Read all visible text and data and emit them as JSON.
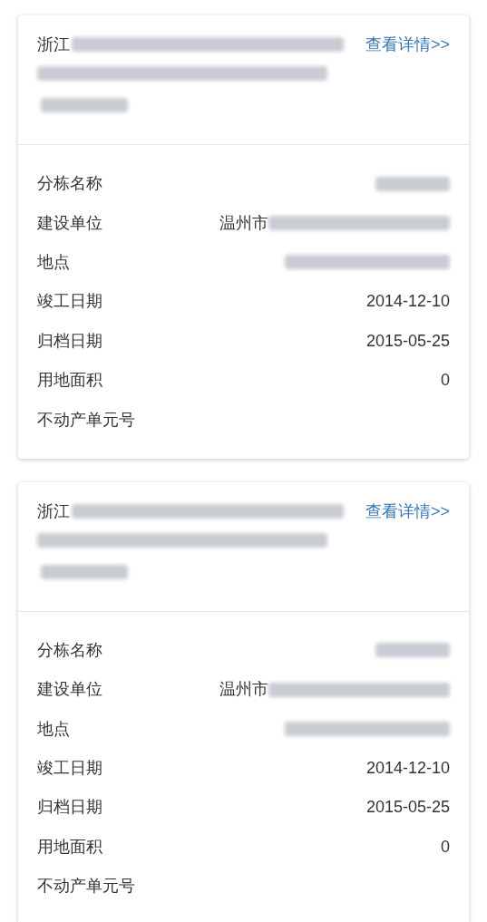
{
  "cards": [
    {
      "title": "浙江",
      "title_redacted": true,
      "detail_link": "查看详情>>",
      "fields": [
        {
          "label": "分栋名称",
          "redacted": true
        },
        {
          "label": "建设单位",
          "value": "温州市",
          "redacted": true
        },
        {
          "label": "地点",
          "redacted": true
        },
        {
          "label": "竣工日期",
          "value": "2014-12-10"
        },
        {
          "label": "归档日期",
          "value": "2015-05-25"
        },
        {
          "label": "用地面积",
          "value": "0"
        },
        {
          "label": "不动产单元号"
        }
      ]
    },
    {
      "title": "浙江",
      "title_redacted": true,
      "detail_link": "查看详情>>",
      "fields": [
        {
          "label": "分栋名称",
          "redacted": true
        },
        {
          "label": "建设单位",
          "value": "温州市",
          "redacted": true
        },
        {
          "label": "地点",
          "redacted": true
        },
        {
          "label": "竣工日期",
          "value": "2014-12-10"
        },
        {
          "label": "归档日期",
          "value": "2015-05-25"
        },
        {
          "label": "用地面积",
          "value": "0"
        },
        {
          "label": "不动产单元号"
        }
      ]
    }
  ]
}
